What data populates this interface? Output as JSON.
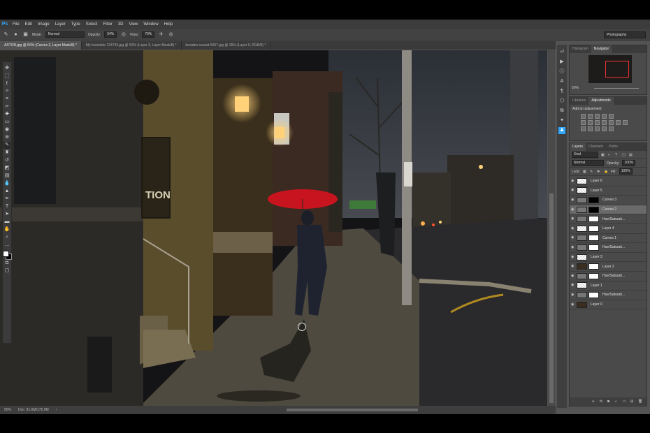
{
  "app": {
    "logo": "Ps"
  },
  "menu": [
    "File",
    "Edit",
    "Image",
    "Layer",
    "Type",
    "Select",
    "Filter",
    "3D",
    "View",
    "Window",
    "Help"
  ],
  "options_bar": {
    "mode_label": "Mode:",
    "mode_value": "Normal",
    "opacity_label": "Opacity:",
    "opacity_value": "34%",
    "flow_label": "Flow:",
    "flow_value": "70%",
    "workspace": "Photography"
  },
  "tabs": [
    {
      "label": "ASTOR.jpg @ 50% (Curves 2, Layer Mask/8) *",
      "active": true
    },
    {
      "label": "My lovelaide-724743.jpg @ 50% (Layer 3, Layer Mask/8) *",
      "active": false
    },
    {
      "label": "bowden sunset-5067.jpg @ 25% (Layer 0, RGB/8) *",
      "active": false
    }
  ],
  "status": {
    "zoom": "50%",
    "doc": "Doc: 81.6M/175.9M"
  },
  "navigator": {
    "tabs": [
      "Histogram",
      "Navigator"
    ],
    "zoom": "50%"
  },
  "adjustments": {
    "tabs": [
      "Libraries",
      "Adjustments"
    ],
    "title": "Add an adjustment"
  },
  "layers": {
    "tabs": [
      "Layers",
      "Channels",
      "Paths"
    ],
    "kind": "Kind",
    "blend": "Normal",
    "opacity_label": "Opacity:",
    "opacity_value": "100%",
    "lock_label": "Lock:",
    "fill_label": "Fill:",
    "fill_value": "100%",
    "items": [
      {
        "name": "Layer 6",
        "thumb": "checker",
        "mask": "",
        "selected": false
      },
      {
        "name": "Layer 5",
        "thumb": "checker",
        "mask": "",
        "selected": false
      },
      {
        "name": "Curves 3",
        "thumb": "adj",
        "mask": "black",
        "selected": false
      },
      {
        "name": "Curves 2",
        "thumb": "adj",
        "mask": "black",
        "selected": true
      },
      {
        "name": "Hue/Saturati...",
        "thumb": "adj",
        "mask": "white",
        "selected": false
      },
      {
        "name": "Layer 4",
        "thumb": "checker",
        "mask": "white",
        "selected": false
      },
      {
        "name": "Curves 1",
        "thumb": "adj",
        "mask": "white",
        "selected": false
      },
      {
        "name": "Hue/Saturati...",
        "thumb": "adj",
        "mask": "white",
        "selected": false
      },
      {
        "name": "Layer 3",
        "thumb": "checker",
        "mask": "",
        "selected": false
      },
      {
        "name": "Layer 2",
        "thumb": "photo",
        "mask": "white",
        "selected": false
      },
      {
        "name": "Hue/Saturati...",
        "thumb": "adj",
        "mask": "white",
        "selected": false
      },
      {
        "name": "Layer 1",
        "thumb": "checker",
        "mask": "",
        "selected": false
      },
      {
        "name": "Hue/Saturati...",
        "thumb": "adj",
        "mask": "white",
        "selected": false
      },
      {
        "name": "Layer 0",
        "thumb": "photo",
        "mask": "",
        "selected": false
      }
    ]
  },
  "photo_sign_text": "TION",
  "colors": {
    "umbrella": "#c8141e",
    "lamp": "#ffd27a",
    "sky": "#3c4048"
  }
}
